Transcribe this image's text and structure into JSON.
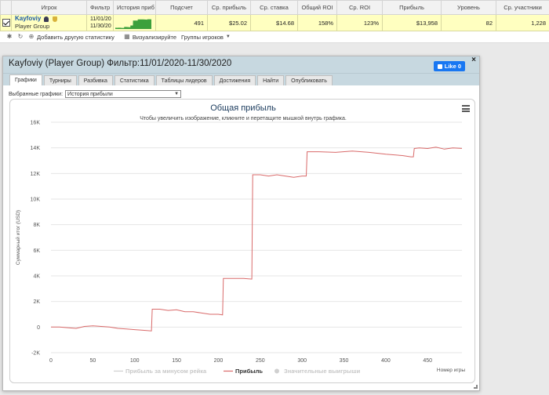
{
  "table": {
    "headers": [
      "Игрок",
      "Фильтр",
      "История приб",
      "Подсчет",
      "Ср. прибыль",
      "Ср. ставка",
      "Общий ROI",
      "Ср. ROI",
      "Прибыль",
      "Уровень",
      "Ср. участники"
    ],
    "row": {
      "player_name": "Kayfoviy",
      "player_group": "Player Group",
      "filter_from": "11/01/20",
      "filter_to": "11/30/20",
      "count": "491",
      "avg_profit": "$25.02",
      "avg_stake": "$14.68",
      "total_roi": "158%",
      "avg_roi": "123%",
      "profit": "$13,958",
      "level": "82",
      "avg_participants": "1,228"
    }
  },
  "toolbar": {
    "add_stats": "Добавить другую статистику",
    "visualize": "Визуализируйте",
    "player_groups": "Группы игроков"
  },
  "dialog": {
    "title": "Kayfoviy (Player Group) Фильтр:11/01/2020-11/30/2020",
    "like_label": "Like 0",
    "close": "×",
    "tabs": [
      "Графики",
      "Турниры",
      "Разбивка",
      "Статистика",
      "Таблицы лидеров",
      "Достижения",
      "Найти",
      "Опубликовать"
    ],
    "active_tab": 0,
    "graph_select_label": "Выбранные графики:",
    "graph_select_value": "История прибыли"
  },
  "colors": {
    "profit_line": "#d96a6a",
    "sparkline": "#3ca03c",
    "header_bg": "#c7d8e0",
    "row_highlight": "#ffffc0",
    "title": "#1a3a5c"
  },
  "chart_data": {
    "type": "line",
    "title": "Общая прибыль",
    "subtitle": "Чтобы увеличить изображение, кликните и перетащите мышкой внутрь графика.",
    "xlabel": "Номер игры",
    "ylabel": "Суммарный итог (USD)",
    "xlim": [
      0,
      491
    ],
    "ylim": [
      -2000,
      16000
    ],
    "x_ticks": [
      "0",
      "50",
      "100",
      "150",
      "200",
      "250",
      "300",
      "350",
      "400",
      "450"
    ],
    "x_tick_values": [
      0,
      50,
      100,
      150,
      200,
      250,
      300,
      350,
      400,
      450
    ],
    "y_ticks": [
      "-2K",
      "0",
      "2K",
      "4K",
      "6K",
      "8K",
      "10K",
      "12K",
      "14K",
      "16K"
    ],
    "y_tick_values": [
      -2000,
      0,
      2000,
      4000,
      6000,
      8000,
      10000,
      12000,
      14000,
      16000
    ],
    "legend": [
      {
        "name": "Прибыль за минусом рейка",
        "active": false
      },
      {
        "name": "Прибыль",
        "active": true
      },
      {
        "name": "Значительные выигрыши",
        "active": false
      }
    ],
    "legend_position": "bottom",
    "series": [
      {
        "name": "Прибыль",
        "x": [
          0,
          10,
          20,
          30,
          40,
          50,
          60,
          70,
          80,
          90,
          100,
          110,
          120,
          121,
          130,
          140,
          150,
          160,
          170,
          180,
          190,
          200,
          205,
          206,
          215,
          230,
          240,
          241,
          250,
          260,
          270,
          280,
          290,
          300,
          305,
          306,
          320,
          340,
          360,
          380,
          400,
          420,
          430,
          433,
          434,
          440,
          450,
          460,
          470,
          480,
          491
        ],
        "y": [
          0,
          0,
          -50,
          -100,
          50,
          100,
          50,
          0,
          -100,
          -150,
          -200,
          -250,
          -300,
          1400,
          1400,
          1300,
          1350,
          1200,
          1200,
          1100,
          1000,
          1000,
          950,
          3800,
          3800,
          3800,
          3750,
          11900,
          11900,
          11800,
          11900,
          11800,
          11700,
          11800,
          11800,
          13700,
          13700,
          13650,
          13750,
          13650,
          13500,
          13400,
          13300,
          13300,
          13950,
          14000,
          13950,
          14050,
          13900,
          14000,
          13958
        ]
      }
    ],
    "grid": true
  }
}
